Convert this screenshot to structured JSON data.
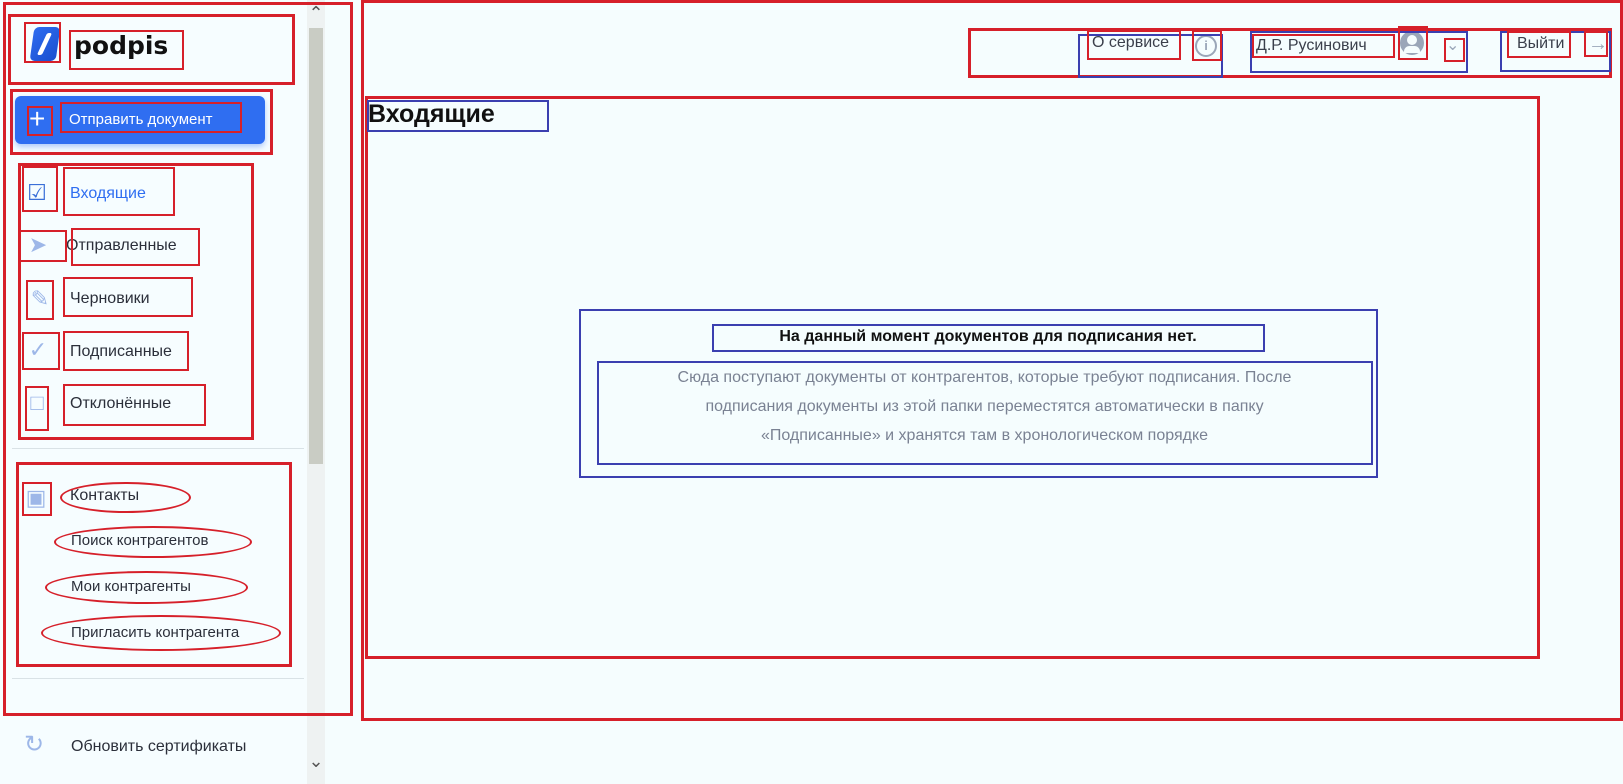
{
  "brand": {
    "name": "podpis"
  },
  "sidebar": {
    "send_button": "Отправить документ",
    "nav": [
      {
        "label": "Входящие",
        "icon": "inbox-icon",
        "active": true
      },
      {
        "label": "Отправленные",
        "icon": "paper-plane-icon",
        "active": false
      },
      {
        "label": "Черновики",
        "icon": "pen-icon",
        "active": false
      },
      {
        "label": "Подписанные",
        "icon": "check-circle-icon",
        "active": false
      },
      {
        "label": "Отклонённые",
        "icon": "trash-icon",
        "active": false
      }
    ],
    "contacts": {
      "label": "Контакты",
      "items": [
        "Поиск контрагентов",
        "Мои контрагенты",
        "Пригласить контрагента"
      ]
    },
    "update_certificates": "Обновить сертификаты"
  },
  "header": {
    "about": "О сервисе",
    "user": "Д.Р. Русинович",
    "logout": "Выйти"
  },
  "main": {
    "title": "Входящие",
    "empty_title": "На данный момент документов для подписания нет.",
    "empty_text_lines": [
      "Сюда поступают документы от контрагентов, которые требуют подписания. После",
      "подписания документы из этой папки переместятся автоматически в папку",
      "«Подписанные» и хранятся там в хронологическом порядке"
    ]
  },
  "colors": {
    "accent": "#2f6ef1",
    "annotation_red": "#d6202a",
    "annotation_blue": "#3b3fb0",
    "background": "#f5fdfe"
  }
}
